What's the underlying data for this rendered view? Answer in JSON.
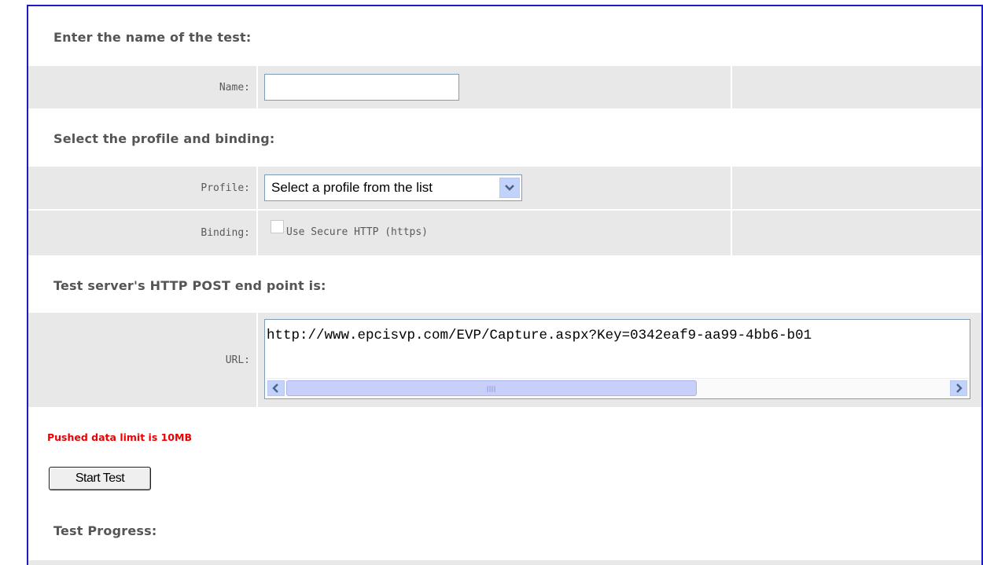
{
  "sections": {
    "name_heading": "Enter the name of the test:",
    "profile_heading": "Select the profile and binding:",
    "endpoint_heading": "Test server's HTTP POST end point is:",
    "progress_heading": "Test Progress:"
  },
  "name_row": {
    "label": "Name:",
    "value": ""
  },
  "profile_row": {
    "label": "Profile:",
    "selected": "Select a profile from the list"
  },
  "binding_row": {
    "label": "Binding:",
    "checkbox_label": "Use Secure HTTP (https)",
    "checked": false
  },
  "url_row": {
    "label": "URL:",
    "value": "http://www.epcisvp.com/EVP/Capture.aspx?Key=0342eaf9-aa99-4bb6-b01"
  },
  "warning": "Pushed data limit is 10MB",
  "start_button": "Start Test",
  "colors": {
    "border": "#1c1cc4",
    "row_bg": "#e8e8e8",
    "warning": "#ee0000",
    "scroll_accent": "#c1d3fb"
  }
}
